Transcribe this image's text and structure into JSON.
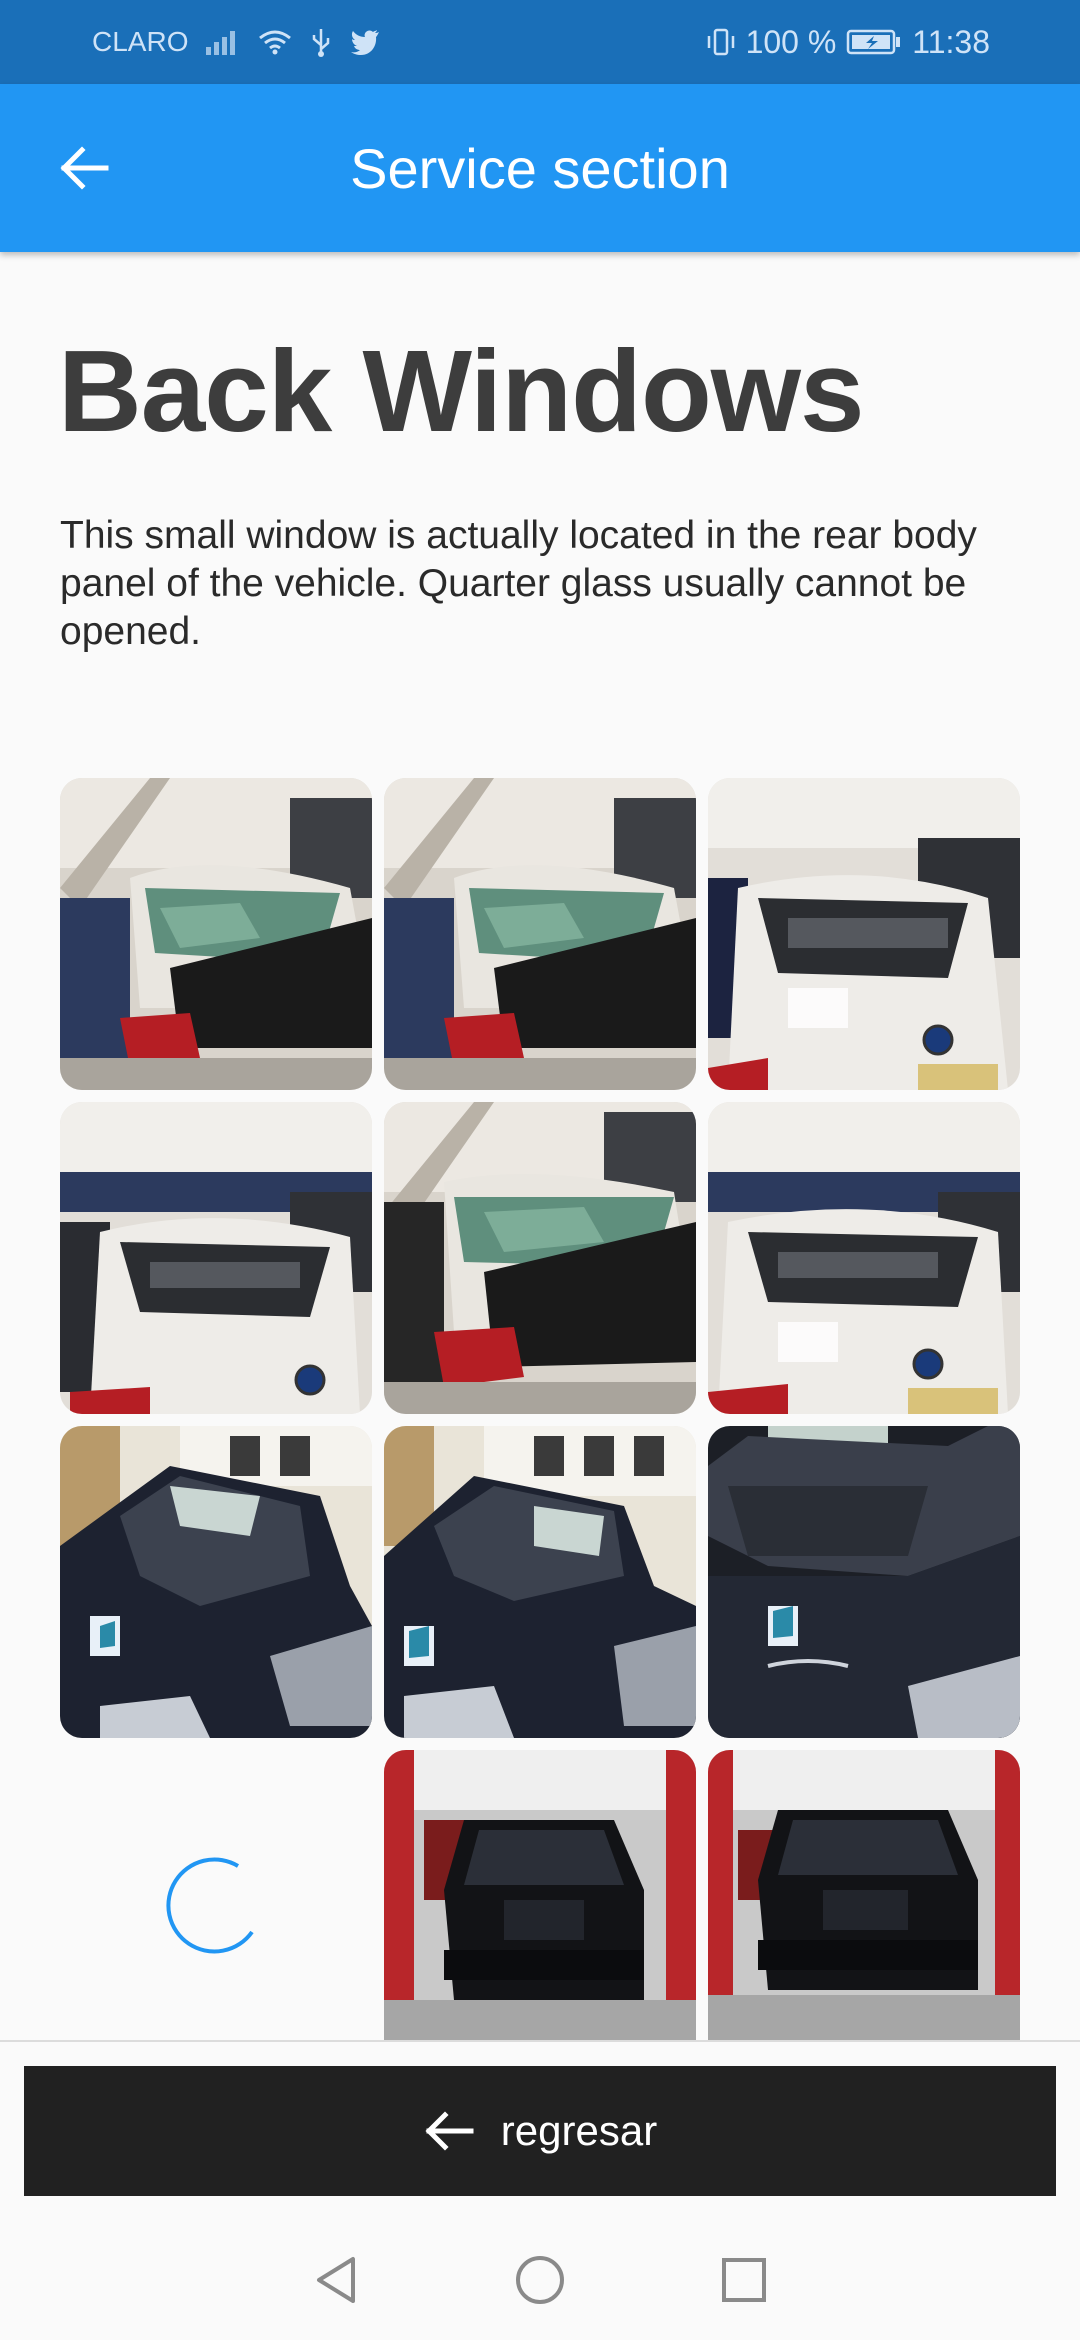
{
  "status_bar": {
    "carrier": "CLARO",
    "battery": "100 %",
    "time": "11:38",
    "icons": [
      "signal-icon",
      "wifi-icon",
      "usb-icon",
      "twitter-icon",
      "vibrate-icon",
      "battery-charging-icon"
    ]
  },
  "app_bar": {
    "title": "Service section",
    "back_icon": "arrow-back-icon"
  },
  "page": {
    "title": "Back Windows",
    "description": "This small window is actually located in the rear body panel of the vehicle. Quarter glass usually cannot be opened."
  },
  "gallery": {
    "photos": [
      {
        "subject": "white sedan rear, shattered rear glass covered with black cloth"
      },
      {
        "subject": "white sedan rear, shattered rear glass covered with black cloth"
      },
      {
        "subject": "white BMW sedan rear window"
      },
      {
        "subject": "white BMW sedan rear window"
      },
      {
        "subject": "white sedan rear, shattered rear glass covered with black cloth"
      },
      {
        "subject": "white BMW sedan rear window"
      },
      {
        "subject": "black SUV rear quarter, missing back glass"
      },
      {
        "subject": "black SUV rear quarter, missing back glass"
      },
      {
        "subject": "black Mazda CX-7 rear quarter, missing back glass"
      },
      {
        "subject": "loading placeholder"
      },
      {
        "subject": "black SUV rear view in garage"
      },
      {
        "subject": "black SUV rear view in garage"
      }
    ]
  },
  "footer": {
    "back_label": "regresar",
    "back_icon": "arrow-back-icon"
  },
  "nav_bar": {
    "icons": [
      "nav-back-icon",
      "nav-home-icon",
      "nav-recents-icon"
    ]
  },
  "colors": {
    "status_bar": "#1a6fb8",
    "app_bar": "#2196f3",
    "button": "#212121",
    "spinner": "#2196f3"
  }
}
